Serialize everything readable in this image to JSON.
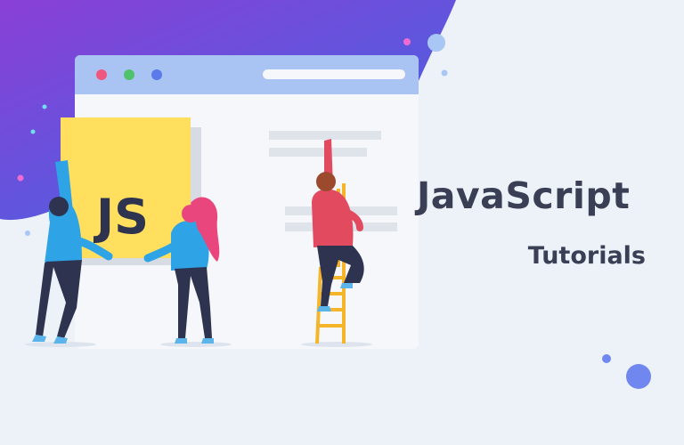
{
  "banner": {
    "title": "JavaScript",
    "subtitle": "Tutorials",
    "logo_text": "JS"
  },
  "colors": {
    "background": "#edf2f9",
    "gradient_start": "#8a3fd6",
    "gradient_end": "#3f67e3",
    "browser_bar": "#a9c3f2",
    "js_yellow": "#ffdf5d",
    "text_dark": "#3a3f55",
    "dot_red": "#f0577f",
    "dot_green": "#4fc26b",
    "dot_blue": "#5b7bea",
    "ladder": "#f4b52b",
    "person_blue": "#2ea3e6",
    "person_red": "#e24b5f",
    "hair_pink": "#e9467e",
    "pants_dark": "#2e3350"
  },
  "icons": [
    "browser-window",
    "js-logo-card",
    "ladder",
    "sparkle-dots"
  ]
}
